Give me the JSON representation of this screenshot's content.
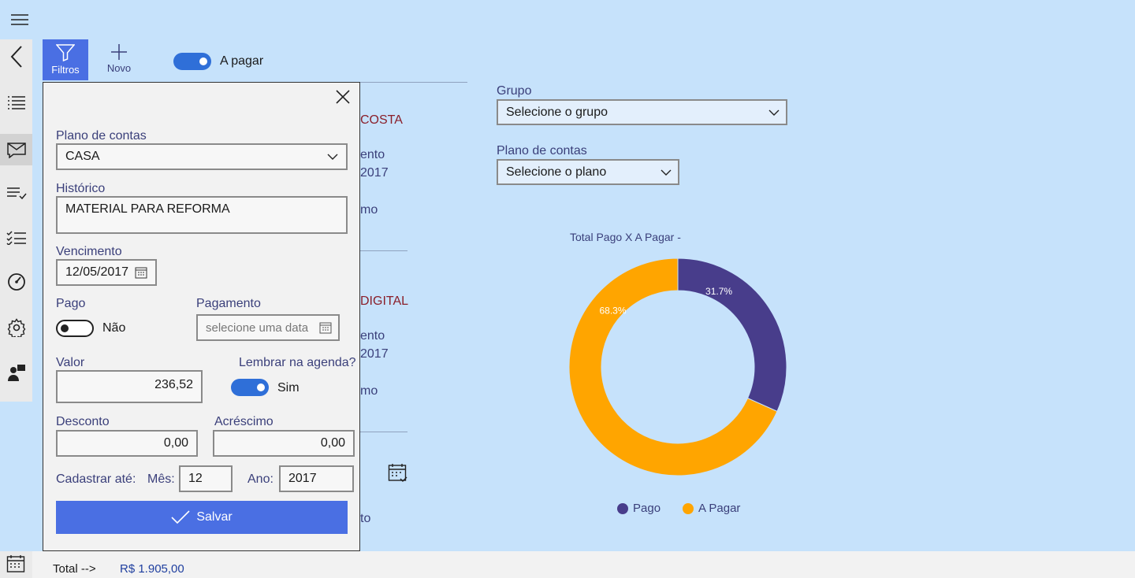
{
  "toolbar": {
    "filter_label": "Filtros",
    "new_label": "Novo",
    "toggle_label": "A pagar"
  },
  "background_list": {
    "item1_title_fragment": "COSTA",
    "item1_line1_fragment": "ento",
    "item1_line2_fragment": "2017",
    "item1_line3_fragment": "mo",
    "item2_title_fragment": "DIGITAL",
    "item2_line1_fragment": "ento",
    "item2_line2_fragment": "2017",
    "item2_line3_fragment": "mo",
    "bottom_fragment": "to"
  },
  "filters": {
    "group_label": "Grupo",
    "group_value": "Selecione o grupo",
    "plan_label": "Plano de contas",
    "plan_value": "Selecione o plano"
  },
  "modal": {
    "plan_label": "Plano de contas",
    "plan_value": "CASA",
    "history_label": "Histórico",
    "history_value": "MATERIAL PARA REFORMA",
    "due_label": "Vencimento",
    "due_value": "12/05/2017",
    "paid_label": "Pago",
    "paid_toggle_text": "Não",
    "payment_label": "Pagamento",
    "payment_placeholder": "selecione uma data",
    "value_label": "Valor",
    "value_value": "236,52",
    "reminder_label": "Lembrar na agenda?",
    "reminder_toggle_text": "Sim",
    "discount_label": "Desconto",
    "discount_value": "0,00",
    "surcharge_label": "Acréscimo",
    "surcharge_value": "0,00",
    "register_until_label": "Cadastrar até:",
    "month_label": "Mês:",
    "month_value": "12",
    "year_label": "Ano:",
    "year_value": "2017",
    "save_label": "Salvar"
  },
  "footer": {
    "total_label": "Total -->",
    "total_value": "R$ 1.905,00"
  },
  "colors": {
    "accent": "#4a6fe3",
    "toggle_on": "#2f6fd8",
    "background": "#c6e2fb",
    "pago": "#483d8b",
    "a_pagar": "#ffa500"
  },
  "icons": [
    "hamburger-icon",
    "back-icon",
    "list-icon",
    "mail-icon",
    "checklist-icon",
    "checklist2-icon",
    "dashboard-icon",
    "gear-icon",
    "user-icon",
    "calendar-icon",
    "filter-icon",
    "plus-icon",
    "close-icon",
    "chevron-down-icon",
    "checkmark-icon"
  ],
  "chart_data": {
    "type": "pie",
    "title": "Total Pago X A Pagar -",
    "categories": [
      "Pago",
      "A Pagar"
    ],
    "values": [
      31.7,
      68.3
    ],
    "labels": [
      "31.7%",
      "68.3%"
    ],
    "colors": [
      "#483d8b",
      "#ffa500"
    ],
    "donut": true,
    "legend": "bottom"
  }
}
